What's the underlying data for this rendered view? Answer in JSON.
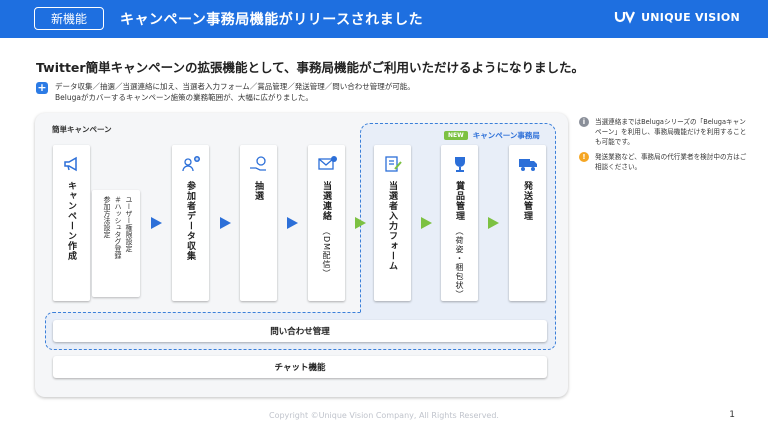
{
  "header": {
    "badge": "新機能",
    "title": "キャンペーン事務局機能がリリースされました",
    "logo_text": "UNIQUE VISION"
  },
  "headline": "Twitter簡単キャンペーンの拡張機能として、事務局機能がご利用いただけるようになりました。",
  "note": {
    "icon": "plus-icon",
    "line1": "データ収集／抽選／当選連絡に加え、当選者入力フォーム／賞品管理／発送管理／問い合わせ管理が可能。",
    "line2": "Belugaがカバーするキャンペーン施策の業務範囲が、大幅に広がりました。"
  },
  "panel": {
    "label": "簡単キャンペーン",
    "new_badge": "NEW",
    "secretariat_label": "キャンペーン事務局"
  },
  "steps": [
    {
      "label": "キャンペーン作成",
      "sub": "",
      "icon": "megaphone-icon"
    },
    {
      "label": "参加者データ収集",
      "sub": "",
      "icon": "people-add-icon"
    },
    {
      "label": "抽選",
      "sub": "",
      "icon": "lottery-hand-icon"
    },
    {
      "label": "当選連絡",
      "sub": "（DM配信）",
      "icon": "mail-icon"
    },
    {
      "label": "当選者入力フォーム",
      "sub": "",
      "icon": "form-edit-icon"
    },
    {
      "label": "賞品管理",
      "sub": "（荷姿・梱包状）",
      "icon": "trophy-icon"
    },
    {
      "label": "発送管理",
      "sub": "",
      "icon": "truck-icon"
    }
  ],
  "campaign_options": [
    "ユーザー権限設定",
    "＃ハッシュタグ登録",
    "参加方法設定"
  ],
  "bars": {
    "inquiry": "問い合わせ管理",
    "chat": "チャット機能"
  },
  "side_notes": [
    {
      "icon": "info-icon",
      "color": "#8a8f99",
      "text": "当選連絡まではBelugaシリーズの「Belugaキャンペーン」を利用し、事務局機能だけを利用することも可能です。"
    },
    {
      "icon": "warning-icon",
      "color": "#f5a623",
      "text": "発送業務など、事務局の代行業者を検討中の方はご相談ください。"
    }
  ],
  "footer": {
    "copyright": "Copyright ©Unique Vision Company, All Rights Reserved.",
    "page": "1"
  },
  "colors": {
    "brand_blue": "#1e6fe0",
    "accent_green": "#7cc142"
  }
}
